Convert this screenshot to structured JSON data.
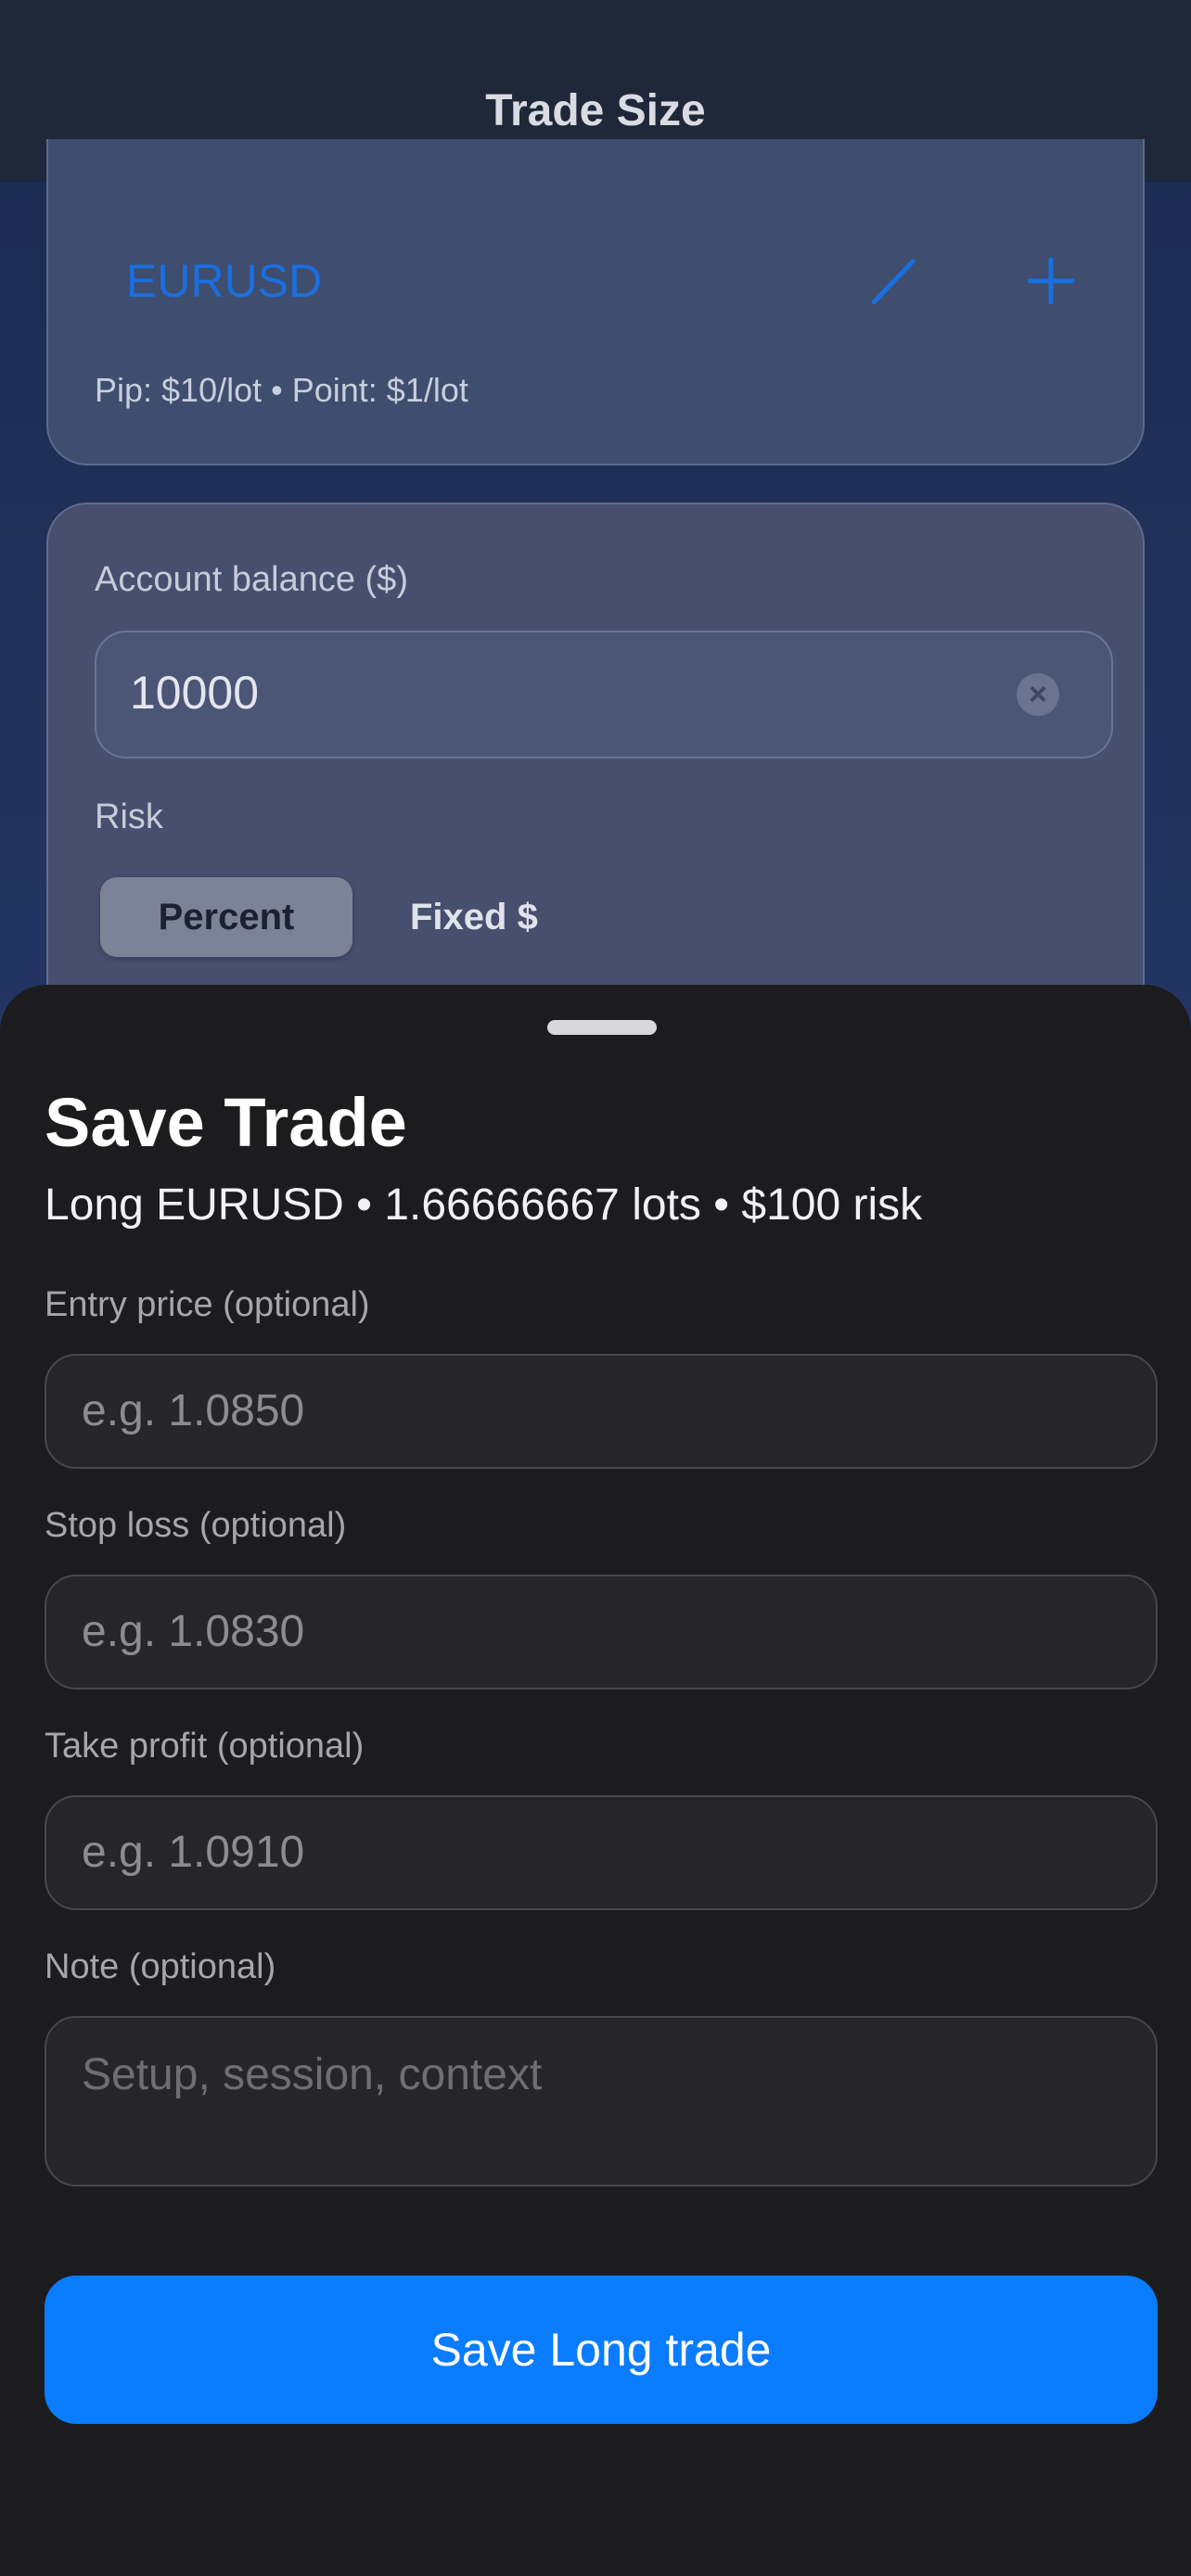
{
  "nav": {
    "title": "Trade Size"
  },
  "symbol_card": {
    "symbol": "EURUSD",
    "pip_info": "Pip: $10/lot • Point: $1/lot",
    "edit_icon": "pencil-icon",
    "add_icon": "plus-icon",
    "accent_color": "#1a6fe0"
  },
  "account_card": {
    "balance_label": "Account balance ($)",
    "balance_value": "10000",
    "risk_label": "Risk",
    "risk_modes": [
      "Percent",
      "Fixed $"
    ],
    "selected_risk_mode": "Percent"
  },
  "sheet": {
    "title": "Save Trade",
    "subtitle": "Long EURUSD • 1.66666667 lots • $100 risk",
    "fields": [
      {
        "label": "Entry price (optional)",
        "placeholder": "e.g. 1.0850"
      },
      {
        "label": "Stop loss (optional)",
        "placeholder": "e.g. 1.0830"
      },
      {
        "label": "Take profit (optional)",
        "placeholder": "e.g. 1.0910"
      },
      {
        "label": "Note (optional)",
        "placeholder": "Setup, session, context"
      }
    ],
    "save_label": "Save Long trade",
    "save_color": "#0a7cff"
  }
}
